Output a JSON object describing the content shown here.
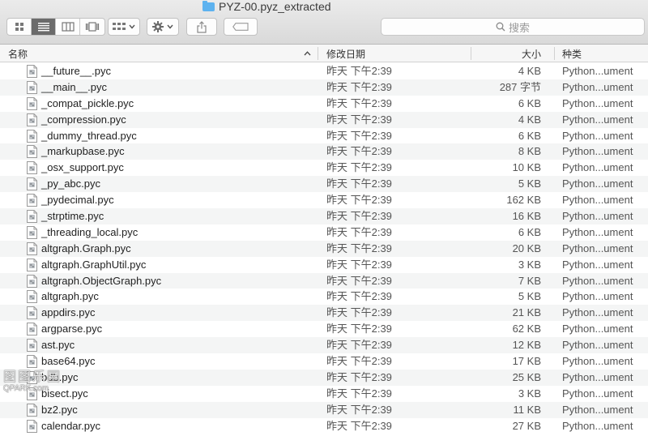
{
  "window": {
    "title": "PYZ-00.pyz_extracted"
  },
  "toolbar": {
    "view_modes": [
      "icon-view-icon",
      "list-view-icon",
      "column-view-icon",
      "gallery-view-icon"
    ],
    "search_placeholder": "搜索"
  },
  "columns": {
    "name": "名称",
    "date": "修改日期",
    "size": "大小",
    "kind": "种类"
  },
  "files": [
    {
      "name": "__future__.pyc",
      "date": "昨天 下午2:39",
      "size": "4 KB",
      "kind": "Python...ument"
    },
    {
      "name": "__main__.pyc",
      "date": "昨天 下午2:39",
      "size": "287 字节",
      "kind": "Python...ument"
    },
    {
      "name": "_compat_pickle.pyc",
      "date": "昨天 下午2:39",
      "size": "6 KB",
      "kind": "Python...ument"
    },
    {
      "name": "_compression.pyc",
      "date": "昨天 下午2:39",
      "size": "4 KB",
      "kind": "Python...ument"
    },
    {
      "name": "_dummy_thread.pyc",
      "date": "昨天 下午2:39",
      "size": "6 KB",
      "kind": "Python...ument"
    },
    {
      "name": "_markupbase.pyc",
      "date": "昨天 下午2:39",
      "size": "8 KB",
      "kind": "Python...ument"
    },
    {
      "name": "_osx_support.pyc",
      "date": "昨天 下午2:39",
      "size": "10 KB",
      "kind": "Python...ument"
    },
    {
      "name": "_py_abc.pyc",
      "date": "昨天 下午2:39",
      "size": "5 KB",
      "kind": "Python...ument"
    },
    {
      "name": "_pydecimal.pyc",
      "date": "昨天 下午2:39",
      "size": "162 KB",
      "kind": "Python...ument"
    },
    {
      "name": "_strptime.pyc",
      "date": "昨天 下午2:39",
      "size": "16 KB",
      "kind": "Python...ument"
    },
    {
      "name": "_threading_local.pyc",
      "date": "昨天 下午2:39",
      "size": "6 KB",
      "kind": "Python...ument"
    },
    {
      "name": "altgraph.Graph.pyc",
      "date": "昨天 下午2:39",
      "size": "20 KB",
      "kind": "Python...ument"
    },
    {
      "name": "altgraph.GraphUtil.pyc",
      "date": "昨天 下午2:39",
      "size": "3 KB",
      "kind": "Python...ument"
    },
    {
      "name": "altgraph.ObjectGraph.pyc",
      "date": "昨天 下午2:39",
      "size": "7 KB",
      "kind": "Python...ument"
    },
    {
      "name": "altgraph.pyc",
      "date": "昨天 下午2:39",
      "size": "5 KB",
      "kind": "Python...ument"
    },
    {
      "name": "appdirs.pyc",
      "date": "昨天 下午2:39",
      "size": "21 KB",
      "kind": "Python...ument"
    },
    {
      "name": "argparse.pyc",
      "date": "昨天 下午2:39",
      "size": "62 KB",
      "kind": "Python...ument"
    },
    {
      "name": "ast.pyc",
      "date": "昨天 下午2:39",
      "size": "12 KB",
      "kind": "Python...ument"
    },
    {
      "name": "base64.pyc",
      "date": "昨天 下午2:39",
      "size": "17 KB",
      "kind": "Python...ument"
    },
    {
      "name": "bdb.pyc",
      "date": "昨天 下午2:39",
      "size": "25 KB",
      "kind": "Python...ument"
    },
    {
      "name": "bisect.pyc",
      "date": "昨天 下午2:39",
      "size": "3 KB",
      "kind": "Python...ument"
    },
    {
      "name": "bz2.pyc",
      "date": "昨天 下午2:39",
      "size": "11 KB",
      "kind": "Python...ument"
    },
    {
      "name": "calendar.pyc",
      "date": "昨天 下午2:39",
      "size": "27 KB",
      "kind": "Python...ument"
    }
  ],
  "watermark": {
    "line1": "图图乐园",
    "line2": "QPARK.com"
  }
}
